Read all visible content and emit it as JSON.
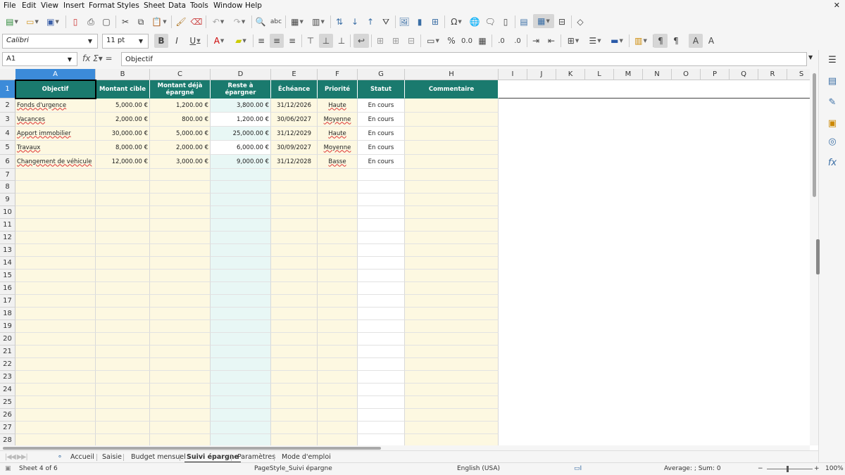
{
  "menu": [
    "File",
    "Edit",
    "View",
    "Insert",
    "Format",
    "Styles",
    "Sheet",
    "Data",
    "Tools",
    "Window",
    "Help"
  ],
  "font": {
    "name": "Calibri",
    "size": "11 pt"
  },
  "name_box": "A1",
  "formula": "Objectif",
  "columns": [
    "A",
    "B",
    "C",
    "D",
    "E",
    "F",
    "G",
    "H",
    "I",
    "J",
    "K",
    "L",
    "M",
    "N",
    "O",
    "P",
    "Q",
    "R",
    "S"
  ],
  "rows": [
    "1",
    "2",
    "3",
    "4",
    "5",
    "6",
    "7",
    "8",
    "9",
    "10",
    "11",
    "12",
    "13",
    "14",
    "15",
    "16",
    "17",
    "18",
    "19",
    "20",
    "21",
    "22",
    "23",
    "24",
    "25",
    "26",
    "27",
    "28"
  ],
  "headers": [
    "Objectif",
    "Montant cible",
    "Montant déjà épargné",
    "Reste à épargner",
    "Échéance",
    "Priorité",
    "Statut",
    "Commentaire"
  ],
  "data_rows": [
    [
      "Fonds d'urgence",
      "5,000.00 €",
      "1,200.00 €",
      "3,800.00 €",
      "31/12/2026",
      "Haute",
      "En cours",
      ""
    ],
    [
      "Vacances",
      "2,000.00 €",
      "800.00 €",
      "1,200.00 €",
      "30/06/2027",
      "Moyenne",
      "En cours",
      ""
    ],
    [
      "Apport immobilier",
      "30,000.00 €",
      "5,000.00 €",
      "25,000.00 €",
      "31/12/2029",
      "Haute",
      "En cours",
      ""
    ],
    [
      "Travaux",
      "8,000.00 €",
      "2,000.00 €",
      "6,000.00 €",
      "30/09/2027",
      "Moyenne",
      "En cours",
      ""
    ],
    [
      "Changement de véhicule",
      "12,000.00 €",
      "3,000.00 €",
      "9,000.00 €",
      "31/12/2028",
      "Basse",
      "En cours",
      ""
    ]
  ],
  "sheet_tabs": [
    "Accueil",
    "Saisie",
    "Budget mensuel",
    "Suivi épargne",
    "Paramètres",
    "Mode d'emploi"
  ],
  "active_tab": "Suivi épargne",
  "status": {
    "sheet": "Sheet 4 of 6",
    "page_style": "PageStyle_Suivi épargne",
    "language": "English (USA)",
    "summary": "Average: ; Sum: 0",
    "zoom": "100%"
  },
  "colors": {
    "header_bg": "#1a7a6e",
    "light_fill": "#fdf8e1",
    "teal_fill": "#e8f7f5",
    "selection": "#3c8bd9"
  }
}
